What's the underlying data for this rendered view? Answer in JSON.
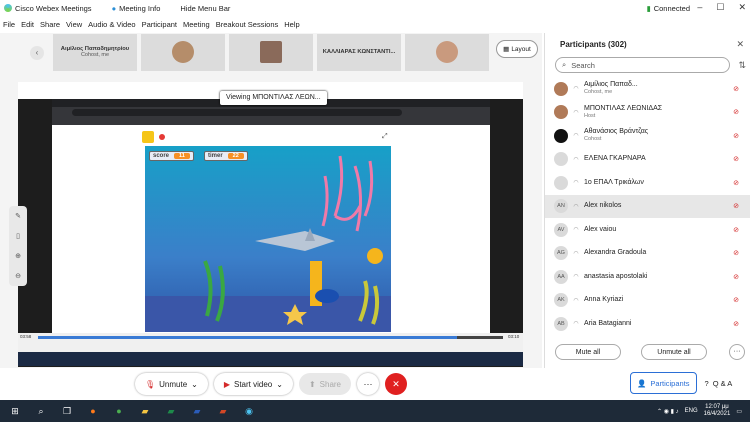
{
  "window": {
    "title": "Cisco Webex Meetings",
    "meeting_info": "Meeting Info",
    "hide_menu": "Hide Menu Bar",
    "status": "Connected"
  },
  "menu": [
    "File",
    "Edit",
    "Share",
    "View",
    "Audio & Video",
    "Participant",
    "Meeting",
    "Breakout Sessions",
    "Help"
  ],
  "thumbnails": [
    {
      "name": "Αιμίλιος Παπαδημητρίου",
      "role": "Cohost, me"
    },
    {
      "name": "",
      "role": ""
    },
    {
      "name": "",
      "role": ""
    },
    {
      "name": "ΚΑΛΛΙΑΡΑΣ ΚΩΝΣΤΑΝΤΙ...",
      "role": ""
    },
    {
      "name": "",
      "role": ""
    }
  ],
  "layout_label": "Layout",
  "share": {
    "viewing": "Viewing ΜΠΟΝΤΙΛΑΣ ΛΕΩΝ...",
    "time_start": "03:58",
    "time_end": "03:10",
    "progress": 0.9
  },
  "game": {
    "score_label": "score",
    "score_value": "11",
    "timer_label": "timer",
    "timer_value": "22"
  },
  "controls": {
    "unmute": "Unmute",
    "start_video": "Start video",
    "share": "Share",
    "more": "···",
    "end": "✕"
  },
  "panel": {
    "title": "Participants (302)",
    "search_placeholder": "Search",
    "participants": [
      {
        "name": "Αιμίλιος Παπαδ...",
        "role": "Cohost, me",
        "initials": "",
        "type": "photo"
      },
      {
        "name": "ΜΠΟΝΤΙΛΑΣ ΛΕΩΝΙΔΑΣ",
        "role": "Host",
        "initials": "",
        "type": "photo"
      },
      {
        "name": "Αθανάσιος Βράντζας",
        "role": "Cohost",
        "initials": "",
        "type": "dark"
      },
      {
        "name": "ΕΛΕΝΑ ΓΚΑΡΝΑΡΑ",
        "role": "",
        "initials": "",
        "type": "blank"
      },
      {
        "name": "1ο ΕΠΑΛ Τρικάλων",
        "role": "",
        "initials": "",
        "type": "blank"
      },
      {
        "name": "Alex nikolos",
        "role": "",
        "initials": "AN",
        "type": "init"
      },
      {
        "name": "Alex vaiou",
        "role": "",
        "initials": "AV",
        "type": "init"
      },
      {
        "name": "Alexandra Gradoula",
        "role": "",
        "initials": "AG",
        "type": "init"
      },
      {
        "name": "anastasia apostolaki",
        "role": "",
        "initials": "AA",
        "type": "init"
      },
      {
        "name": "Anna Kyriazi",
        "role": "",
        "initials": "AK",
        "type": "init"
      },
      {
        "name": "Aria Batagianni",
        "role": "",
        "initials": "AB",
        "type": "init"
      }
    ],
    "mute_all": "Mute all",
    "unmute_all": "Unmute all",
    "more": "···"
  },
  "right_tabs": {
    "participants": "Participants",
    "qa": "Q & A"
  },
  "taskbar": {
    "lang": "ENG",
    "time": "12:07 μμ",
    "date": "16/4/2021"
  }
}
